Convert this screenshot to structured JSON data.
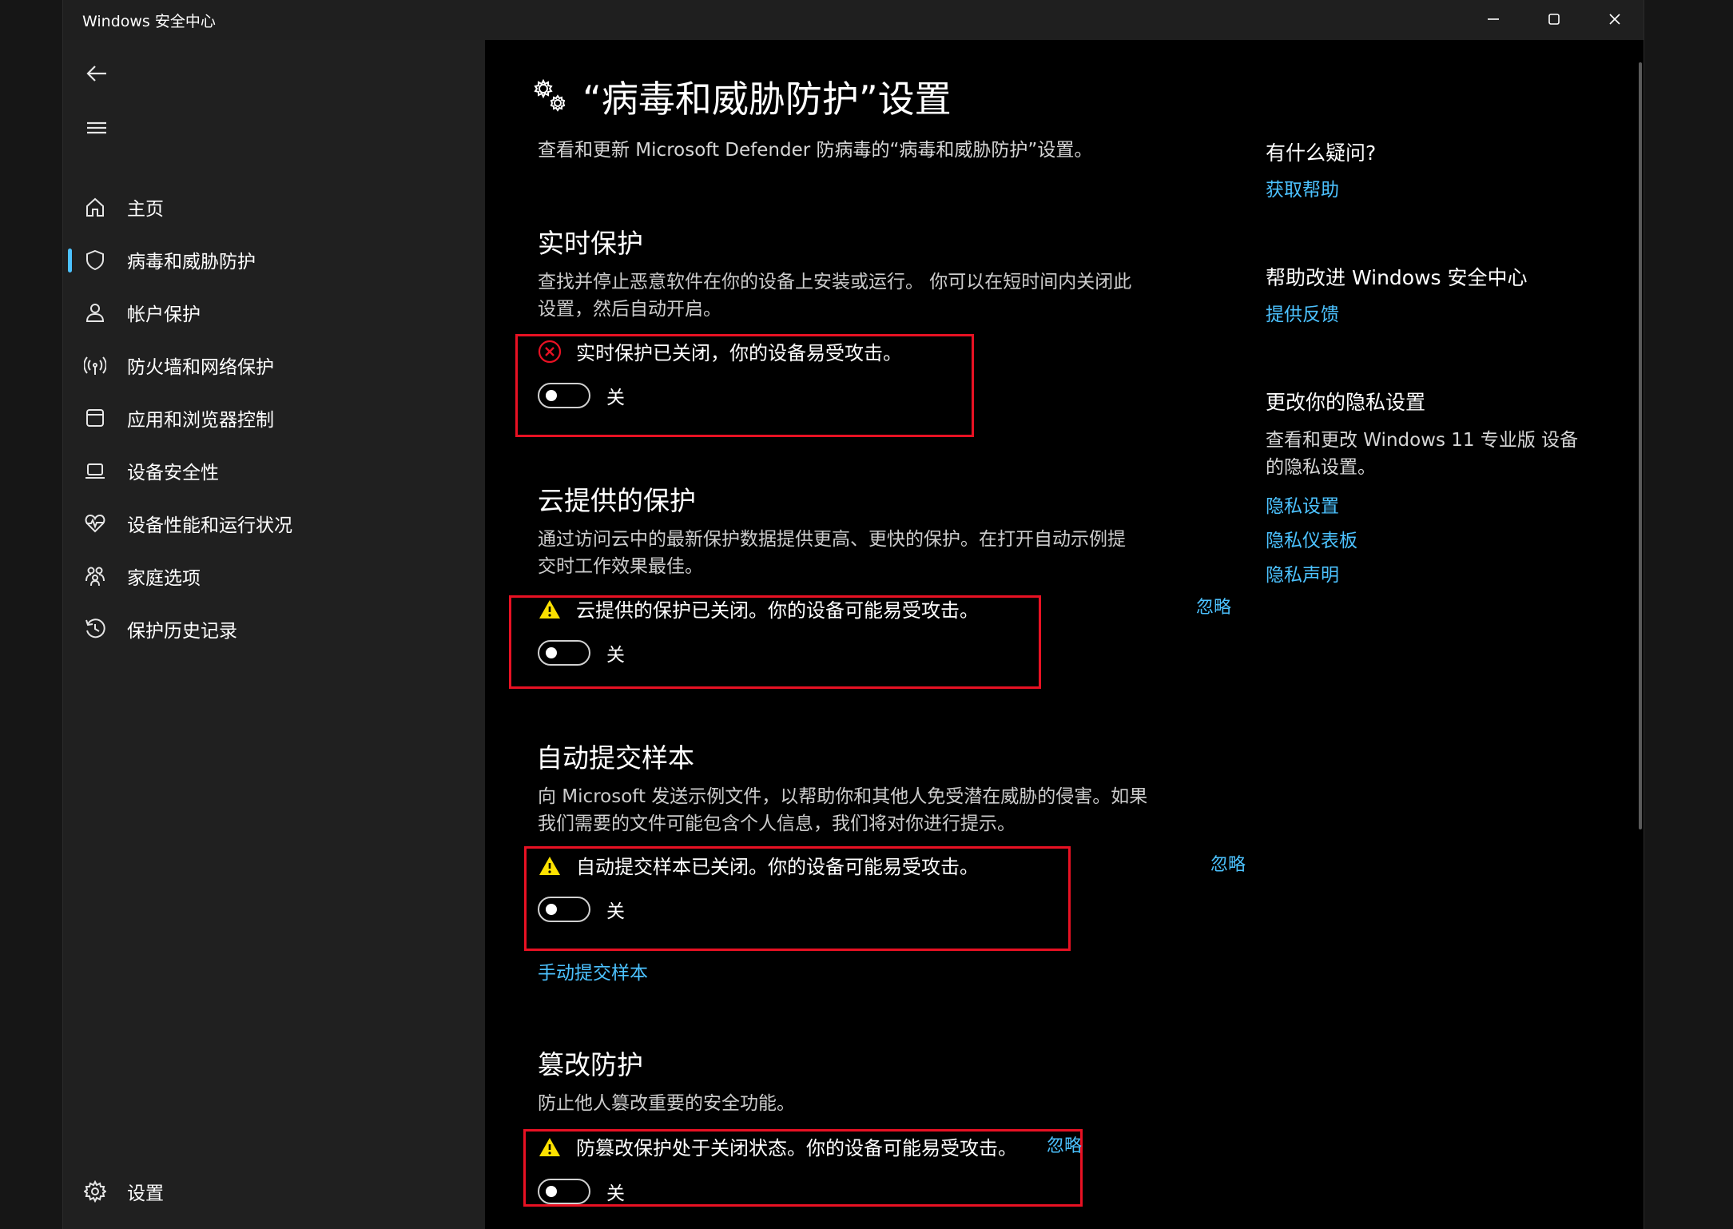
{
  "window": {
    "title": "Windows 安全中心"
  },
  "nav": {
    "items": [
      {
        "label": "主页",
        "icon": "home-icon"
      },
      {
        "label": "病毒和威胁防护",
        "icon": "shield-icon"
      },
      {
        "label": "帐户保护",
        "icon": "person-icon"
      },
      {
        "label": "防火墙和网络保护",
        "icon": "wifi-antenna-icon"
      },
      {
        "label": "应用和浏览器控制",
        "icon": "app-window-icon"
      },
      {
        "label": "设备安全性",
        "icon": "laptop-icon"
      },
      {
        "label": "设备性能和运行状况",
        "icon": "heart-pulse-icon"
      },
      {
        "label": "家庭选项",
        "icon": "family-icon"
      },
      {
        "label": "保护历史记录",
        "icon": "history-icon"
      }
    ],
    "active_index": 1,
    "settings_label": "设置"
  },
  "page": {
    "title": "“病毒和威胁防护”设置",
    "description": "查看和更新 Microsoft Defender 防病毒的“病毒和威胁防护”设置。"
  },
  "sections": [
    {
      "title": "实时保护",
      "desc_lines": [
        "查找并停止恶意软件在你的设备上安装或运行。 你可以在短时间内关闭此",
        "设置，然后自动开启。"
      ],
      "alert_text": "实时保护已关闭，你的设备易受攻击。",
      "alert_type": "error",
      "toggle_label": "关",
      "toggle_on": false
    },
    {
      "title": "云提供的保护",
      "desc_lines": [
        "通过访问云中的最新保护数据提供更高、更快的保护。在打开自动示例提",
        "交时工作效果最佳。"
      ],
      "alert_text": "云提供的保护已关闭。你的设备可能易受攻击。",
      "alert_type": "warning",
      "ignore_label": "忽略",
      "toggle_label": "关",
      "toggle_on": false
    },
    {
      "title": "自动提交样本",
      "desc_lines": [
        "向 Microsoft 发送示例文件，以帮助你和其他人免受潜在威胁的侵害。如果",
        "我们需要的文件可能包含个人信息，我们将对你进行提示。"
      ],
      "alert_text": "自动提交样本已关闭。你的设备可能易受攻击。",
      "alert_type": "warning",
      "ignore_label": "忽略",
      "toggle_label": "关",
      "toggle_on": false,
      "link_label": "手动提交样本"
    },
    {
      "title": "篡改防护",
      "desc_lines": [
        "防止他人篡改重要的安全功能。"
      ],
      "alert_text": "防篡改保护处于关闭状态。你的设备可能易受攻击。",
      "alert_type": "warning",
      "ignore_label": "忽略",
      "toggle_label": "关",
      "toggle_on": false
    }
  ],
  "aside": {
    "questions_title": "有什么疑问?",
    "get_help": "获取帮助",
    "improve_title": "帮助改进 Windows 安全中心",
    "feedback": "提供反馈",
    "privacy_title": "更改你的隐私设置",
    "privacy_lines": [
      "查看和更改 Windows 11 专业版 设备",
      "的隐私设置。"
    ],
    "privacy_settings": "隐私设置",
    "privacy_dashboard": "隐私仪表板",
    "privacy_statement": "隐私声明"
  },
  "colors": {
    "accent": "#4cc2ff",
    "error": "#e81123",
    "warning": "#fce100",
    "highlight_box": "#e81123"
  }
}
